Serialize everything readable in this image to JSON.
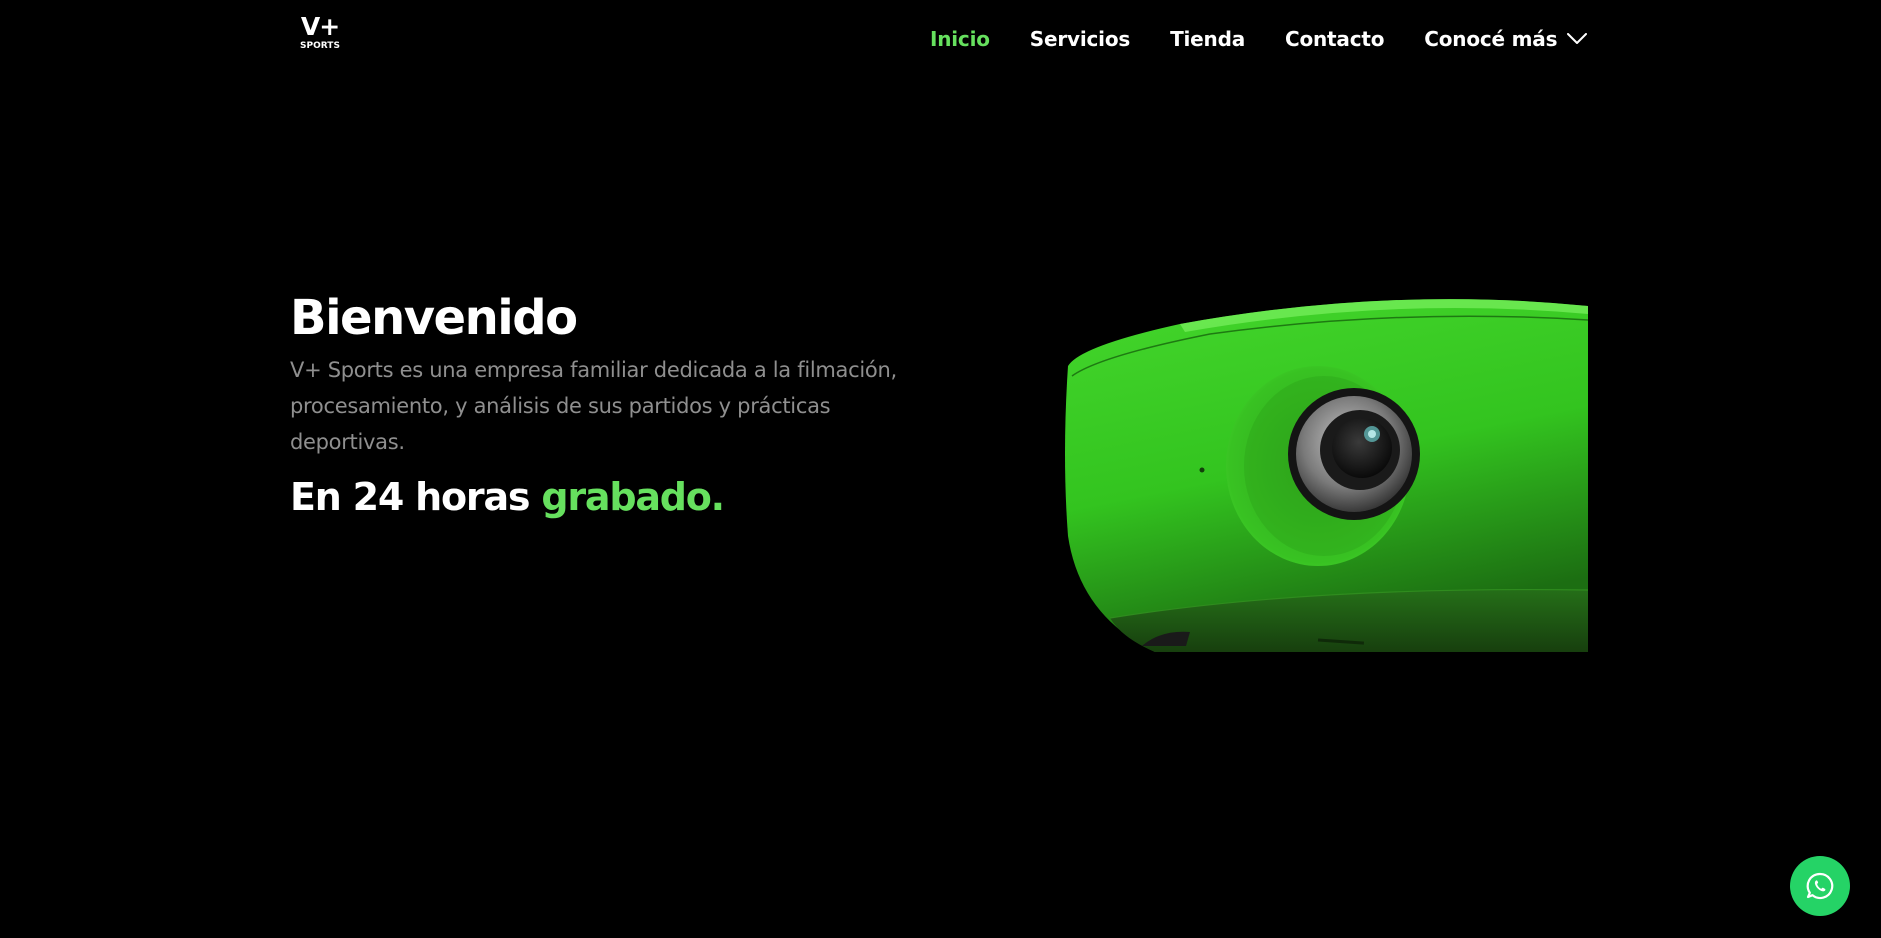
{
  "logo": {
    "main": "V+",
    "sub": "SPORTS"
  },
  "nav": {
    "items": [
      {
        "label": "Inicio",
        "active": true
      },
      {
        "label": "Servicios",
        "active": false
      },
      {
        "label": "Tienda",
        "active": false
      },
      {
        "label": "Contacto",
        "active": false
      }
    ],
    "dropdown": {
      "label": "Conocé más",
      "icon": "chevron-down-icon"
    }
  },
  "hero": {
    "title": "Bienvenido",
    "description": "V+ Sports es una empresa familiar dedicada a la filmación, procesamiento, y análisis de sus partidos y prácticas deportivas.",
    "tagline_prefix": "En 24 horas",
    "tagline_accent": "grabado.",
    "image_subject": "green-camera"
  },
  "floating": {
    "whatsapp_icon": "whatsapp-icon"
  },
  "colors": {
    "background": "#000000",
    "accent": "#66e05e",
    "text": "#ffffff",
    "muted": "#8f8f8f",
    "whatsapp": "#25d366"
  }
}
